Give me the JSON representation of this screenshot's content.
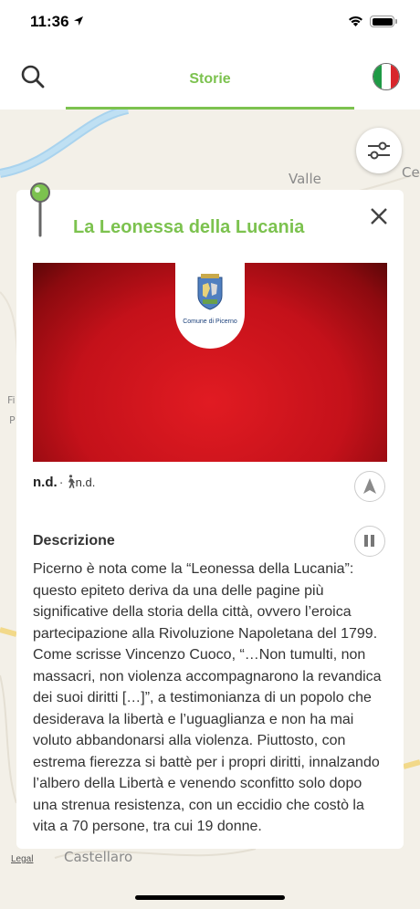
{
  "status_bar": {
    "time": "11:36"
  },
  "header": {
    "tab_label": "Storie"
  },
  "map": {
    "labels": {
      "valle": "Valle",
      "cesin": "Cesin",
      "castellaro": "Castellaro",
      "f": "Fi",
      "p": "P"
    },
    "legal": "Legal"
  },
  "card": {
    "title": "La Leonessa della Lucania",
    "badge_label": "Comune di Picerno",
    "distance": "n.d.",
    "walk_time": "n.d.",
    "description_title": "Descrizione",
    "description": "Picerno è nota come la “Leonessa della Lucania”: questo epiteto deriva da una delle pagine più significative della storia della città, ovvero l’eroica partecipazione alla Rivoluzione Napoletana del 1799. Come scrisse Vincenzo Cuoco, “…Non tumulti, non massacri, non violenza accompagnarono la revandica dei suoi diritti […]”, a testimonianza di un popolo che desiderava la libertà e l’uguaglianza e non ha mai voluto abbandonarsi alla violenza. Piuttosto, con estrema fierezza si battè per i propri diritti, innalzando l’albero della Libertà e venendo sconfitto solo dopo una strenua resistenza, con un eccidio che costò la vita a 70 persone, tra cui 19 donne."
  },
  "colors": {
    "accent": "#7cc24f",
    "hero_red": "#c4111a"
  },
  "icons": [
    "search-icon",
    "flag-italy-icon",
    "filter-sliders-icon",
    "map-pin-icon",
    "close-icon",
    "walk-icon",
    "navigation-arrow-icon",
    "pause-icon"
  ]
}
